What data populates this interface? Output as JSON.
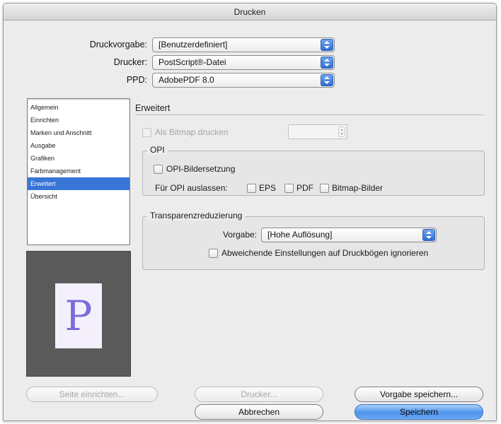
{
  "window": {
    "title": "Drucken"
  },
  "header": {
    "preset_label": "Druckvorgabe:",
    "preset_value": "[Benutzerdefiniert]",
    "printer_label": "Drucker:",
    "printer_value": "PostScript®-Datei",
    "ppd_label": "PPD:",
    "ppd_value": "AdobePDF 8.0"
  },
  "sidebar": {
    "items": [
      {
        "label": "Allgemein"
      },
      {
        "label": "Einrichten"
      },
      {
        "label": "Marken und Anschnitt"
      },
      {
        "label": "Ausgabe"
      },
      {
        "label": "Grafiken"
      },
      {
        "label": "Farbmanagement"
      },
      {
        "label": "Erweitert"
      },
      {
        "label": "Übersicht"
      }
    ],
    "selected_index": 6
  },
  "preview": {
    "glyph": "P"
  },
  "panel": {
    "title": "Erweitert",
    "bitmap_label": "Als Bitmap drucken",
    "opi": {
      "group_title": "OPI",
      "replace_label": "OPI-Bildersetzung",
      "omit_label": "Für OPI auslassen:",
      "eps_label": "EPS",
      "pdf_label": "PDF",
      "bitmap_label": "Bitmap-Bilder"
    },
    "transparency": {
      "group_title": "Transparenzreduzierung",
      "preset_label": "Vorgabe:",
      "preset_value": "[Hohe Auflösung]",
      "ignore_label": "Abweichende Einstellungen auf Druckbögen ignorieren"
    }
  },
  "footer": {
    "page_setup": "Seite einrichten...",
    "printer": "Drucker...",
    "save_preset": "Vorgabe speichern...",
    "cancel": "Abbrechen",
    "save": "Speichern"
  }
}
